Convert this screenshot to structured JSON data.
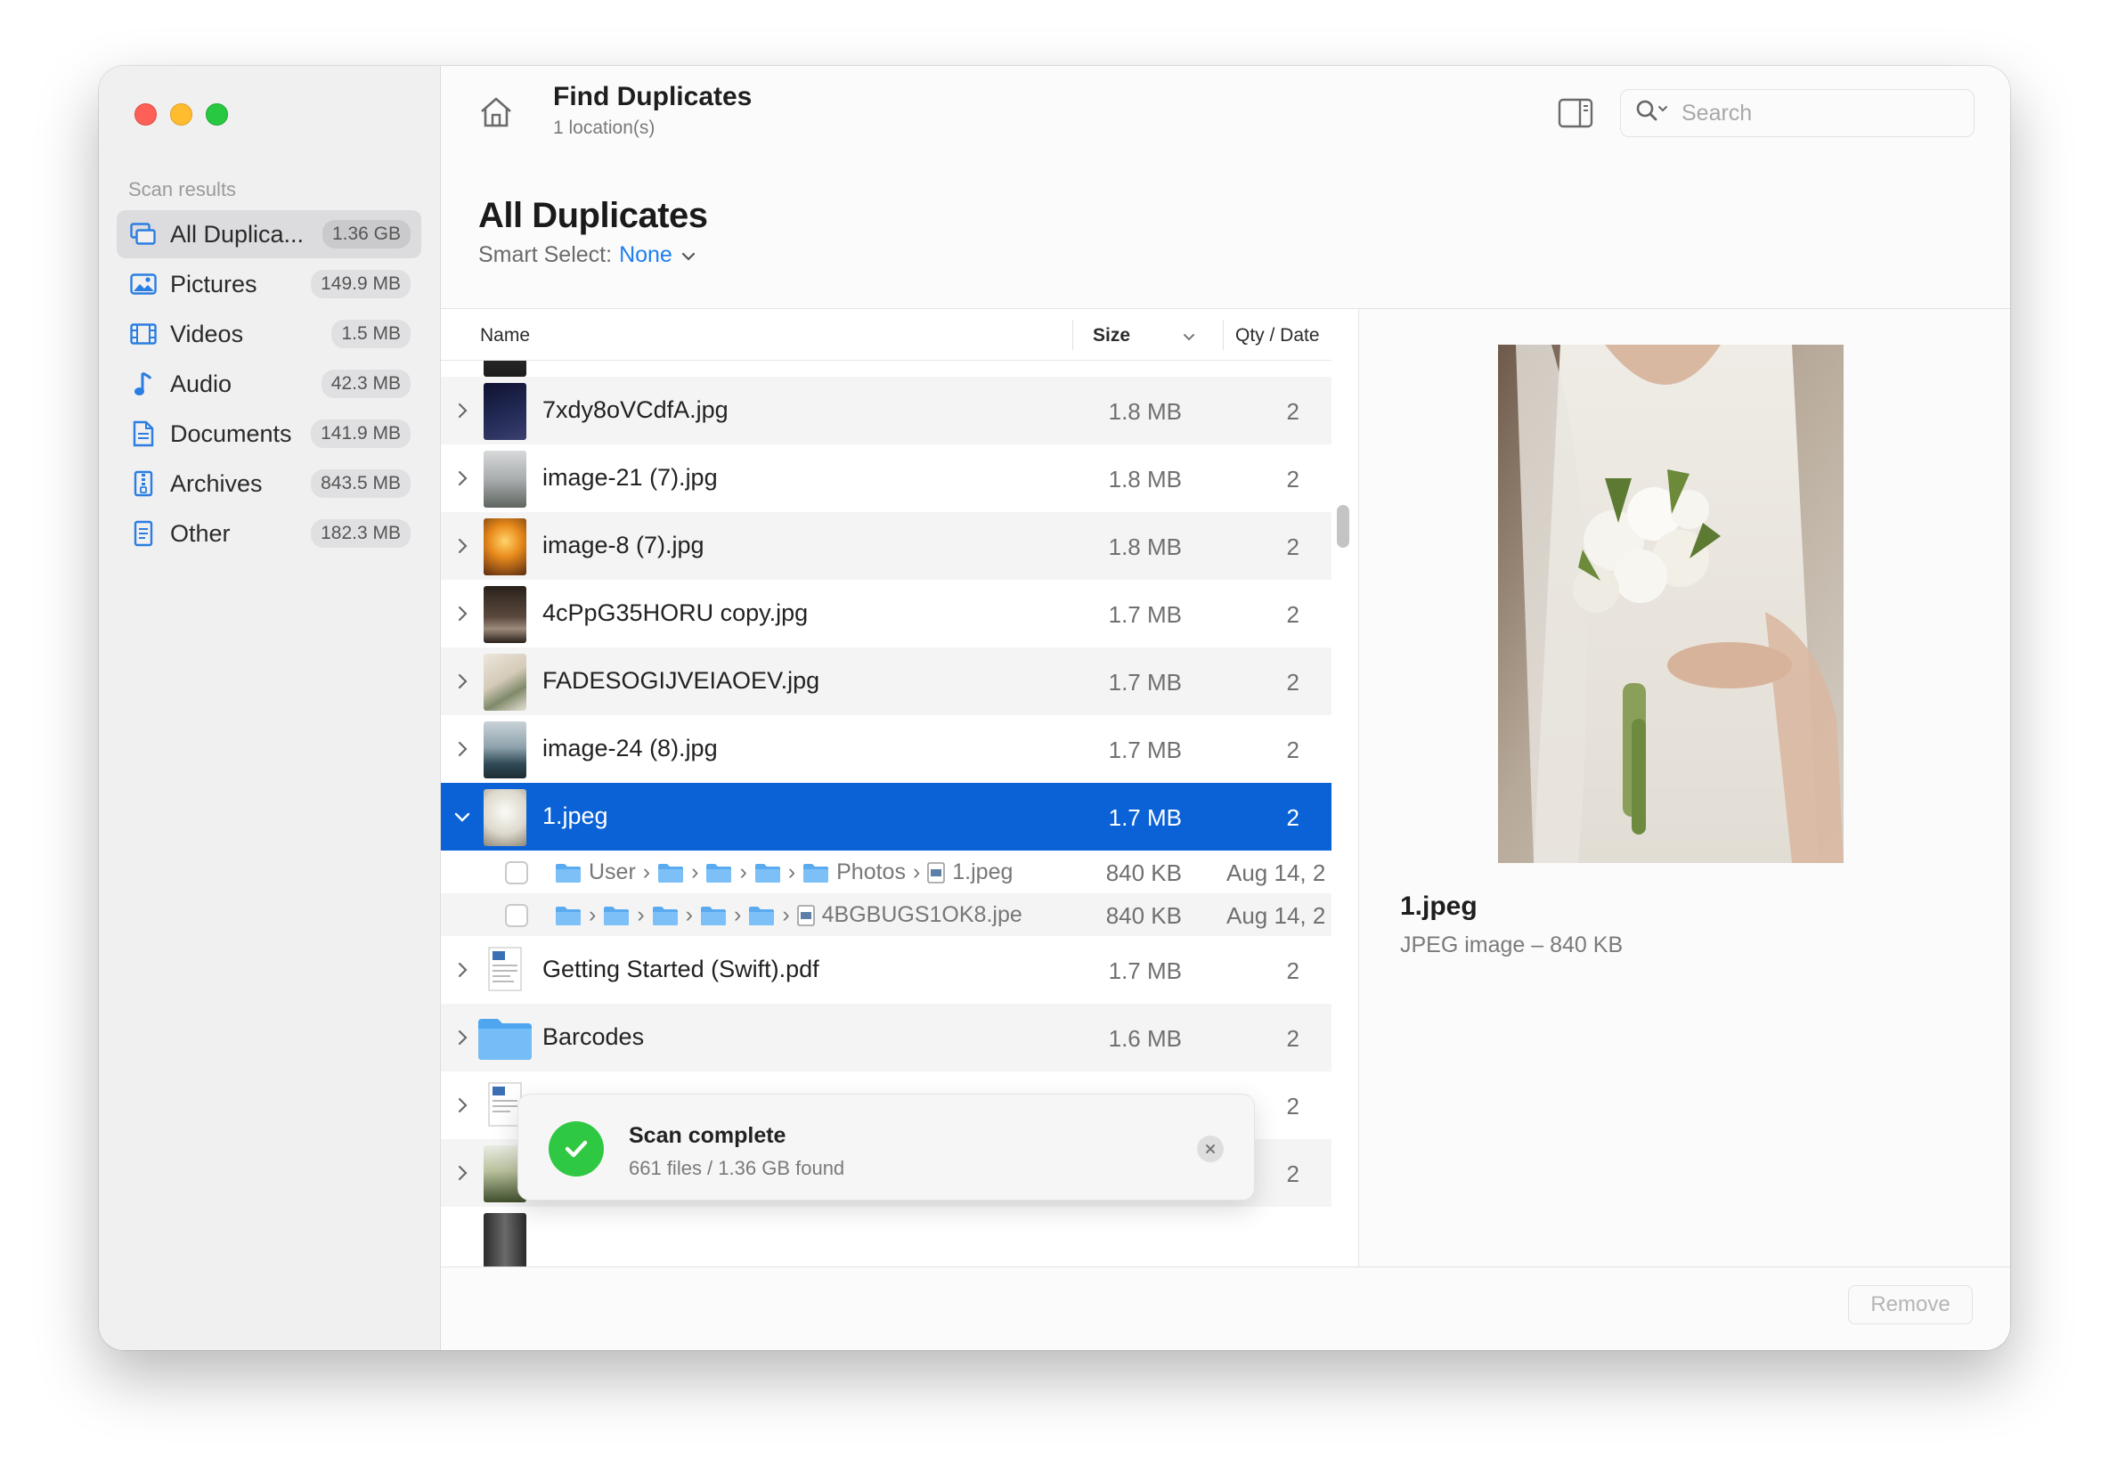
{
  "window": {
    "title": "Find Duplicates",
    "subtitle": "1 location(s)"
  },
  "search": {
    "placeholder": "Search"
  },
  "sidebar": {
    "heading": "Scan results",
    "items": [
      {
        "label": "All Duplica...",
        "badge": "1.36 GB",
        "icon": "duplicates-icon",
        "active": true
      },
      {
        "label": "Pictures",
        "badge": "149.9 MB",
        "icon": "picture-icon"
      },
      {
        "label": "Videos",
        "badge": "1.5 MB",
        "icon": "film-icon"
      },
      {
        "label": "Audio",
        "badge": "42.3 MB",
        "icon": "music-note-icon"
      },
      {
        "label": "Documents",
        "badge": "141.9 MB",
        "icon": "document-icon"
      },
      {
        "label": "Archives",
        "badge": "843.5 MB",
        "icon": "archive-icon"
      },
      {
        "label": "Other",
        "badge": "182.3 MB",
        "icon": "file-icon"
      }
    ]
  },
  "main": {
    "title": "All Duplicates",
    "smart_select_label": "Smart Select:",
    "smart_select_value": "None"
  },
  "table": {
    "columns": {
      "name": "Name",
      "size": "Size",
      "qty": "Qty / Date"
    },
    "rows": [
      {
        "name": "7xdy8oVCdfA.jpg",
        "size": "1.8 MB",
        "qty": "2"
      },
      {
        "name": "image-21 (7).jpg",
        "size": "1.8 MB",
        "qty": "2"
      },
      {
        "name": "image-8 (7).jpg",
        "size": "1.8 MB",
        "qty": "2"
      },
      {
        "name": "4cPpG35HORU copy.jpg",
        "size": "1.7 MB",
        "qty": "2"
      },
      {
        "name": "FADESOGIJVEIAOEV.jpg",
        "size": "1.7 MB",
        "qty": "2"
      },
      {
        "name": "image-24 (8).jpg",
        "size": "1.7 MB",
        "qty": "2"
      },
      {
        "name": "1.jpeg",
        "size": "1.7 MB",
        "qty": "2",
        "selected": true
      },
      {
        "name": "Getting Started (Swift).pdf",
        "size": "1.7 MB",
        "qty": "2"
      },
      {
        "name": "Barcodes",
        "size": "1.6 MB",
        "qty": "2"
      },
      {
        "name": "",
        "size": "",
        "qty": "2"
      },
      {
        "name": "",
        "size": "",
        "qty": "2"
      }
    ],
    "children": [
      {
        "path_start": "User",
        "path_folder": "Photos",
        "file": "1.jpeg",
        "size": "840 KB",
        "date": "Aug 14, 2"
      },
      {
        "file": "4BGBUGS1OK8.jpe",
        "size": "840 KB",
        "date": "Aug 14, 2"
      }
    ]
  },
  "toast": {
    "title": "Scan complete",
    "detail": "661 files / 1.36 GB found"
  },
  "preview": {
    "name": "1.jpeg",
    "meta": "JPEG image – 840 KB"
  },
  "actions": {
    "remove_label": "Remove"
  },
  "colors": {
    "accent": "#0b62d6",
    "link": "#1f7ff0",
    "success": "#2fc842"
  }
}
